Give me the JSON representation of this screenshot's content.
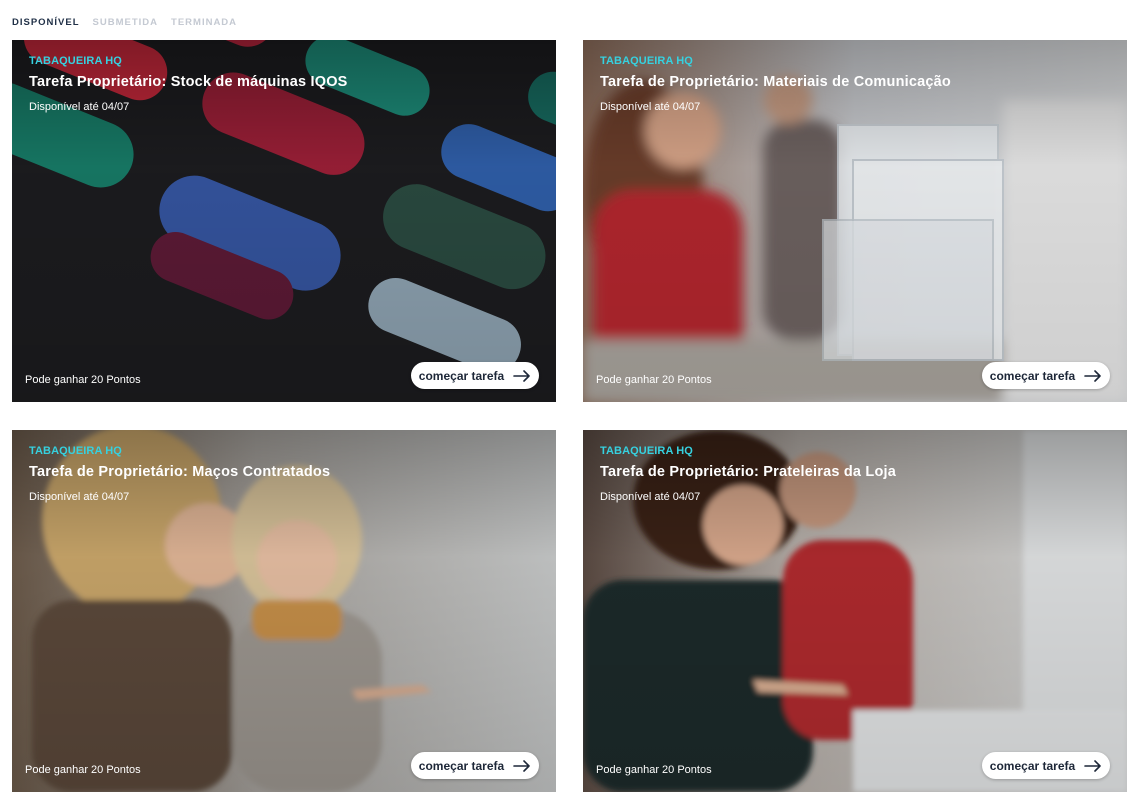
{
  "tabs": [
    {
      "label": "DISPONÍVEL",
      "active": true
    },
    {
      "label": "SUBMETIDA",
      "active": false
    },
    {
      "label": "TERMINADA",
      "active": false
    }
  ],
  "colors": {
    "brand_accent": "#36d1e0",
    "active_tab": "#1f2f46",
    "inactive_tab": "#c4c9d2",
    "button_bg": "#ffffff",
    "button_text": "#1d2738"
  },
  "cards": [
    {
      "brand": "TABAQUEIRA HQ",
      "title": "Tarefa Proprietário: Stock de máquinas IQOS",
      "availability": "Disponível até 04/07",
      "points": "Pode ganhar 20 Pontos",
      "button_label": "começar tarefa",
      "button_icon": "arrow-right-icon"
    },
    {
      "brand": "TABAQUEIRA HQ",
      "title": "Tarefa de Proprietário: Materiais de Comunicação",
      "availability": "Disponível até 04/07",
      "points": "Pode ganhar 20 Pontos",
      "button_label": "começar tarefa",
      "button_icon": "arrow-right-icon"
    },
    {
      "brand": "TABAQUEIRA HQ",
      "title": "Tarefa de Proprietário: Maços Contratados",
      "availability": "Disponível até 04/07",
      "points": "Pode ganhar 20 Pontos",
      "button_label": "começar tarefa",
      "button_icon": "arrow-right-icon"
    },
    {
      "brand": "TABAQUEIRA HQ",
      "title": "Tarefa de Proprietário: Prateleiras da Loja",
      "availability": "Disponível até 04/07",
      "points": "Pode ganhar 20 Pontos",
      "button_label": "começar tarefa",
      "button_icon": "arrow-right-icon"
    }
  ]
}
